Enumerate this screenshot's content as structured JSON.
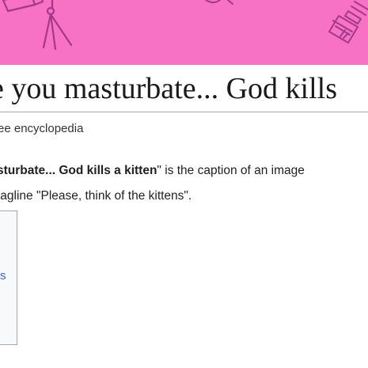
{
  "article": {
    "title": "e you masturbate... God kills",
    "tagline": "ee encyclopedia",
    "lead": {
      "line1_bold": "sturbate... God kills a kitten",
      "line1_rest": "\" is the caption of an image",
      "line2": "tagline \"Please, think of the kittens\"."
    }
  },
  "toc": {
    "link_fragment": "s"
  },
  "colors": {
    "banner": "#f771c4",
    "banner_ink": "#a23a8c",
    "link": "#3366cc"
  },
  "banner_icons": [
    "telescope-icon",
    "satellite-icon"
  ]
}
